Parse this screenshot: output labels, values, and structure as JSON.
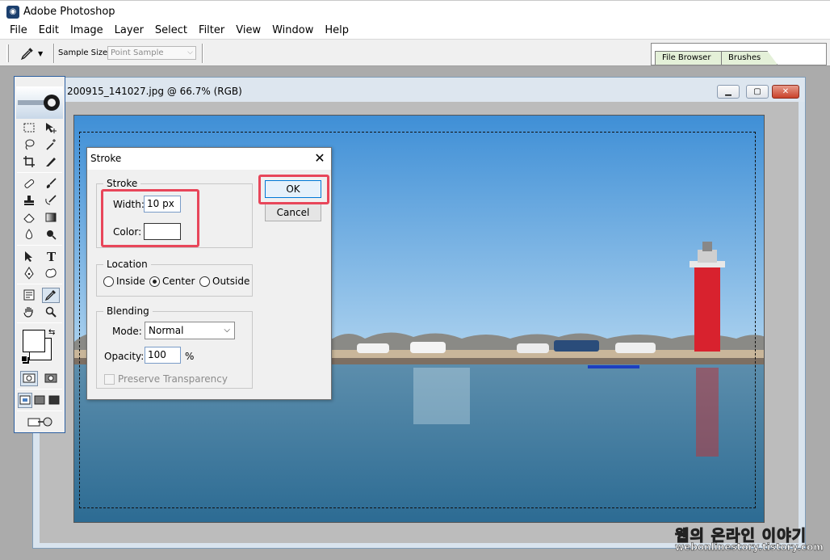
{
  "app": {
    "title": "Adobe Photoshop"
  },
  "menu": [
    "File",
    "Edit",
    "Image",
    "Layer",
    "Select",
    "Filter",
    "View",
    "Window",
    "Help"
  ],
  "options_bar": {
    "tool_icon": "eyedropper-icon",
    "sample_size_label": "Sample Size:",
    "sample_size_value": "Point Sample"
  },
  "palette_well": {
    "tabs": [
      "File Browser",
      "Brushes"
    ]
  },
  "document": {
    "title": "200915_141027.jpg @ 66.7% (RGB)",
    "window_buttons": [
      "minimize-icon",
      "maximize-icon",
      "close-icon"
    ]
  },
  "dialog": {
    "title": "Stroke",
    "close_glyph": "✕",
    "stroke_group": {
      "label": "Stroke",
      "width_label": "Width:",
      "width_value": "10 px",
      "color_label": "Color:"
    },
    "location_group": {
      "label": "Location",
      "options": [
        "Inside",
        "Center",
        "Outside"
      ],
      "selected": "Center"
    },
    "blending_group": {
      "label": "Blending",
      "mode_label": "Mode:",
      "mode_value": "Normal",
      "opacity_label": "Opacity:",
      "opacity_value": "100",
      "opacity_unit": "%",
      "preserve_label": "Preserve Transparency"
    },
    "ok_label": "OK",
    "cancel_label": "Cancel"
  },
  "watermark": {
    "korean": "웹의 온라인 이야기",
    "url": "webonlinestory.tistory.com"
  },
  "colors": {
    "highlight": "#e8465a",
    "toolbox_border": "#2d5fa0",
    "ok_focus": "#0078d7"
  }
}
